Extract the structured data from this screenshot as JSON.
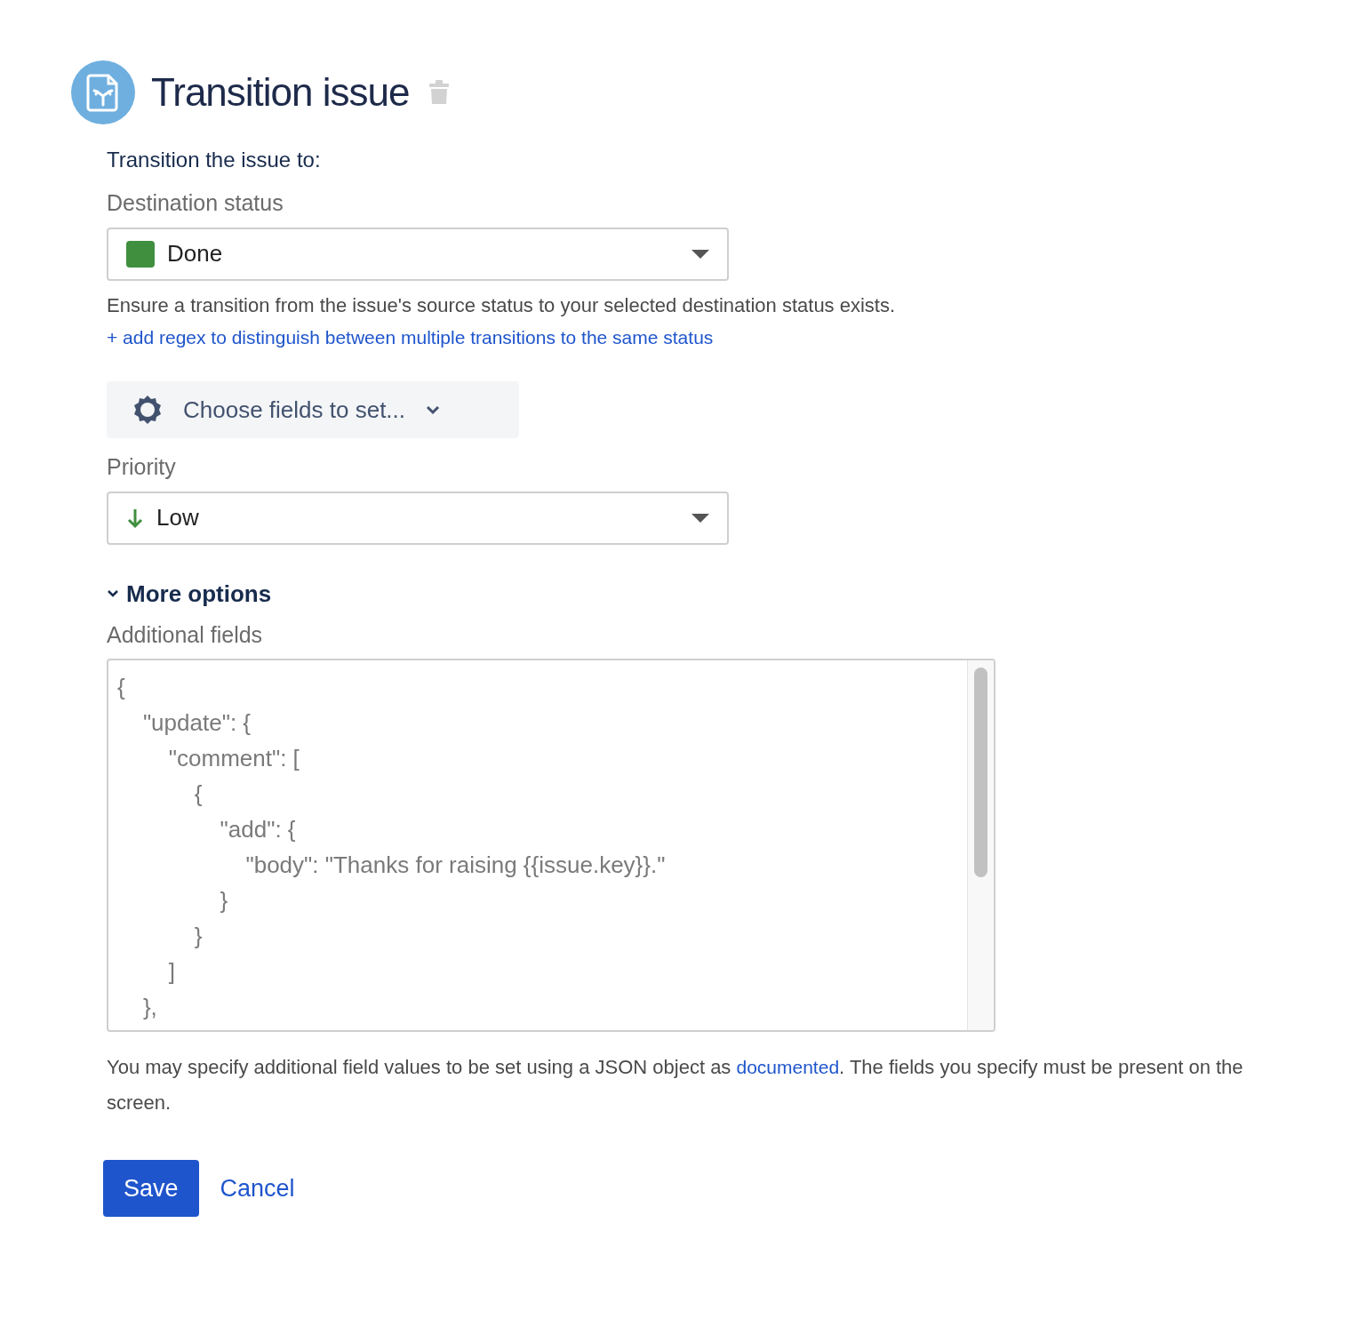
{
  "header": {
    "title": "Transition issue"
  },
  "intro": "Transition the issue to:",
  "destination": {
    "label": "Destination status",
    "value": "Done",
    "color": "#3f8f3f",
    "help": "Ensure a transition from the issue's source status to your selected destination status exists.",
    "link": "+ add regex to distinguish between multiple transitions to the same status"
  },
  "fields_button": {
    "label": "Choose fields to set..."
  },
  "priority": {
    "label": "Priority",
    "value": "Low"
  },
  "more_options": {
    "label": "More options",
    "expanded": true
  },
  "additional_fields": {
    "label": "Additional fields",
    "value": "{\n    \"update\": {\n        \"comment\": [\n            {\n                \"add\": {\n                    \"body\": \"Thanks for raising {{issue.key}}.\"\n                }\n            }\n        ]\n    },",
    "help_before": "You may specify additional field values to be set using a JSON object as ",
    "help_link": "documented",
    "help_after": ". The fields you specify must be present on the screen."
  },
  "buttons": [
    {
      "label": "Save",
      "kind": "primary"
    },
    {
      "label": "Cancel",
      "kind": "link"
    }
  ]
}
